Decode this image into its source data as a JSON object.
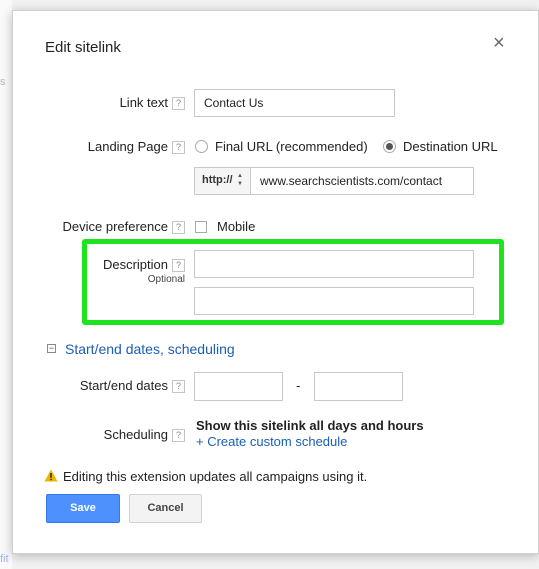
{
  "dialog": {
    "title": "Edit sitelink",
    "close_glyph": "×"
  },
  "link_text": {
    "label": "Link text",
    "help": "?",
    "value": "Contact Us"
  },
  "landing_page": {
    "label": "Landing Page",
    "help": "?",
    "options": [
      "Final URL (recommended)",
      "Destination URL"
    ],
    "selected": "Destination URL",
    "protocol": "http://",
    "protocol_arrows": "▲▼",
    "url": "www.searchscientists.com/contact"
  },
  "device_preference": {
    "label": "Device preference",
    "help": "?",
    "option": "Mobile",
    "checked": false
  },
  "description": {
    "label": "Description",
    "help": "?",
    "sublabel": "Optional",
    "line1": "",
    "line2": ""
  },
  "dates_section": {
    "toggle_glyph": "−",
    "title": "Start/end dates, scheduling"
  },
  "start_end": {
    "label": "Start/end dates",
    "help": "?",
    "separator": "-",
    "start": "",
    "end": ""
  },
  "scheduling": {
    "label": "Scheduling",
    "help": "?",
    "summary": "Show this sitelink all days and hours",
    "create_link": "+ Create custom schedule"
  },
  "warning": {
    "icon": "warning-icon",
    "text": "Editing this extension updates all campaigns using it."
  },
  "buttons": {
    "save": "Save",
    "cancel": "Cancel"
  },
  "colors": {
    "highlight": "#1ee31e",
    "link": "#1a5fb4",
    "primary_button": "#4d90fe",
    "warning": "#f0b400"
  }
}
